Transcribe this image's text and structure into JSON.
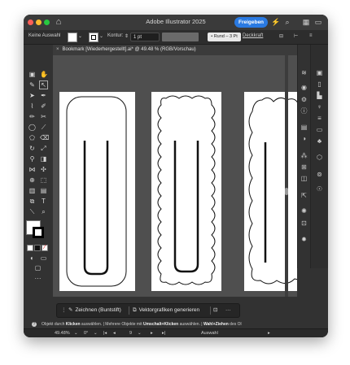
{
  "window": {
    "title": "Adobe Illustrator 2025",
    "share_label": "Freigeben"
  },
  "control_bar": {
    "selection_label": "Keine Auswahl",
    "stroke_label": "Kontur:",
    "stroke_value": "1 pt",
    "brush_label": "Rund – 3 Pt",
    "opacity_label": "Deckkraft"
  },
  "document_tab": {
    "title": "Bookmark [Wiederhergestellt].ai* @ 49.48 % (RGB/Vorschau)"
  },
  "context_bar": {
    "draw_label": "Zeichnen (Buntstift)",
    "vector_label": "Vektorgrafiken generieren",
    "more_label": "···"
  },
  "hint_bar": {
    "p1": "Objekt durch ",
    "p1b": "Klicken",
    "p2": " auswählen. | Mehrere Objekte mit ",
    "p2b": "Umschalt+Klicken",
    "p3": " auswählen. | ",
    "p3b": "Wahl+Ziehen",
    "p4": " des Ol"
  },
  "status_bar": {
    "zoom": "49.48%",
    "rotation": "0°",
    "artboard_number": "9",
    "tool_mode": "Auswahl"
  },
  "colors": {
    "accent": "#2a7ae2",
    "canvas_bg": "#4f4f4f",
    "ui_bg": "#323232"
  }
}
